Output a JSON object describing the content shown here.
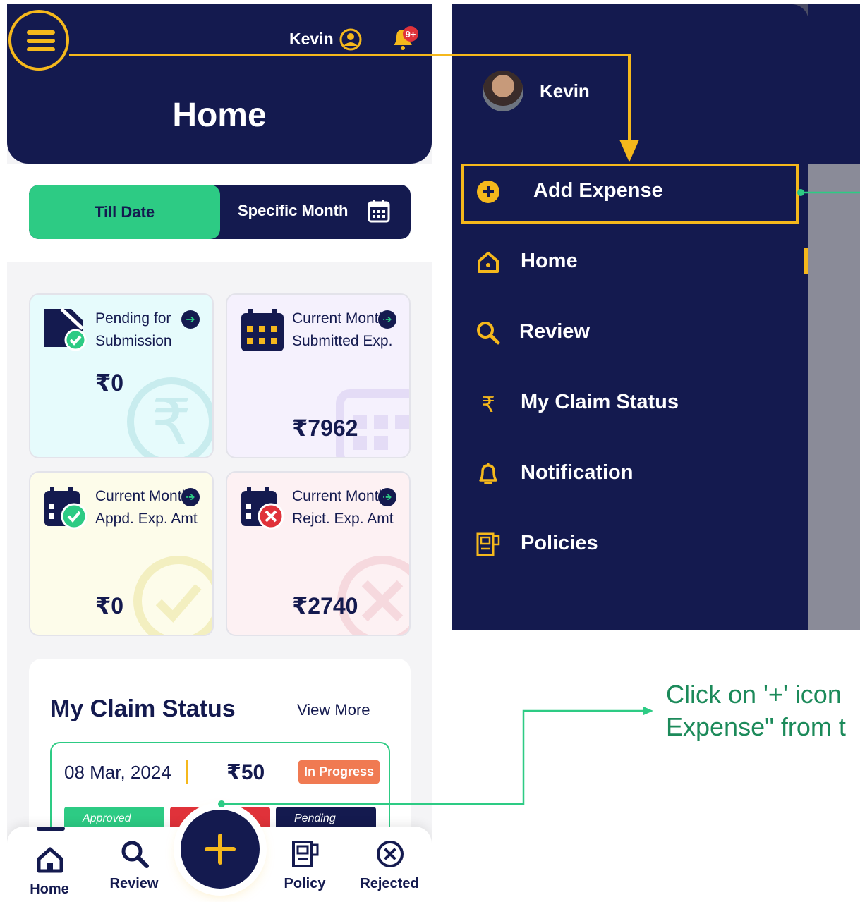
{
  "header": {
    "user_name": "Kevin",
    "notification_badge": "9+",
    "title": "Home"
  },
  "tabs": {
    "till_date": "Till Date",
    "specific_month": "Specific Month"
  },
  "cards": [
    {
      "title": "Pending for Submission",
      "value": "₹0",
      "bg": "#e6fbfc"
    },
    {
      "title": "Current Month Submitted Exp.",
      "value": "₹7962",
      "bg": "#f5f1fd"
    },
    {
      "title": "Current Month Appd. Exp. Amt",
      "value": "₹0",
      "bg": "#fdfcea"
    },
    {
      "title": "Current Month Rejct. Exp. Amt",
      "value": "₹2740",
      "bg": "#fdf1f3"
    }
  ],
  "claim_status": {
    "title": "My Claim Status",
    "view_more": "View More",
    "item": {
      "date": "08 Mar, 2024",
      "amount": "₹50",
      "status": "In Progress",
      "chip_approved": "Approved",
      "chip_pending": "Pending"
    }
  },
  "bottom_nav": {
    "home": "Home",
    "review": "Review",
    "policy": "Policy",
    "rejected": "Rejected"
  },
  "drawer": {
    "user_name": "Kevin",
    "items": [
      {
        "label": "Add Expense",
        "icon": "plus-circle-icon"
      },
      {
        "label": "Home",
        "icon": "home-icon"
      },
      {
        "label": "Review",
        "icon": "search-icon"
      },
      {
        "label": "My Claim Status",
        "icon": "rupee-icon"
      },
      {
        "label": "Notification",
        "icon": "bell-icon"
      },
      {
        "label": "Policies",
        "icon": "policy-icon"
      }
    ]
  },
  "callout": {
    "line1": "Click on  '+' icon",
    "line2": "Expense\" from t"
  },
  "colors": {
    "navy": "#141a4f",
    "green": "#2dcb84",
    "yellow": "#f5b81c",
    "badge": "#f07a52"
  }
}
